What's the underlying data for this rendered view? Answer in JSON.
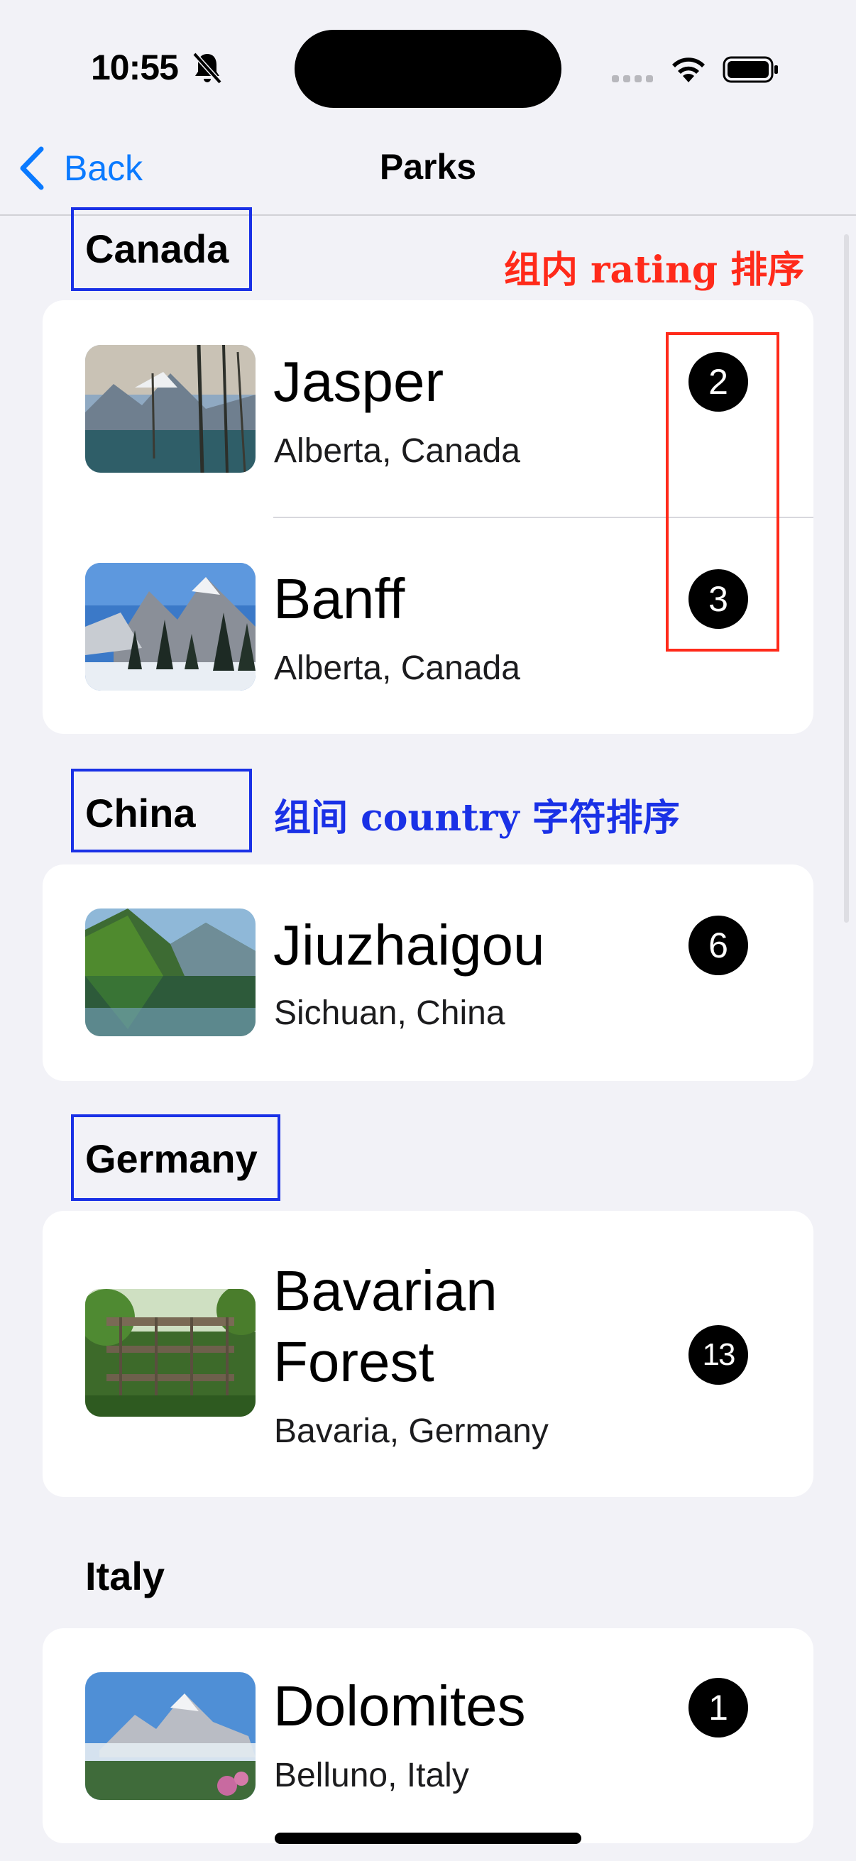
{
  "status_bar": {
    "time": "10:55",
    "icons": [
      "bell-slash-icon",
      "cellular-signal-icon",
      "wifi-icon",
      "battery-icon"
    ]
  },
  "navbar": {
    "back_label": "Back",
    "title": "Parks"
  },
  "annotations": {
    "in_group": "组内 rating 排序",
    "between_groups": "组间 country 字符排序",
    "colors": {
      "red": "#ff2a1a",
      "blue": "#1a31e6"
    }
  },
  "sections": [
    {
      "header": "Canada",
      "parks": [
        {
          "name": "Jasper",
          "location": "Alberta, Canada",
          "rating": "2"
        },
        {
          "name": "Banff",
          "location": "Alberta, Canada",
          "rating": "3"
        }
      ]
    },
    {
      "header": "China",
      "parks": [
        {
          "name": "Jiuzhaigou",
          "location": "Sichuan, China",
          "rating": "6"
        }
      ]
    },
    {
      "header": "Germany",
      "parks": [
        {
          "name": "Bavarian Forest",
          "location": "Bavaria, Germany",
          "rating": "13"
        }
      ]
    },
    {
      "header": "Italy",
      "parks": [
        {
          "name": "Dolomites",
          "location": "Belluno, Italy",
          "rating": "1"
        }
      ]
    }
  ],
  "accent_color": "#0a7aff"
}
